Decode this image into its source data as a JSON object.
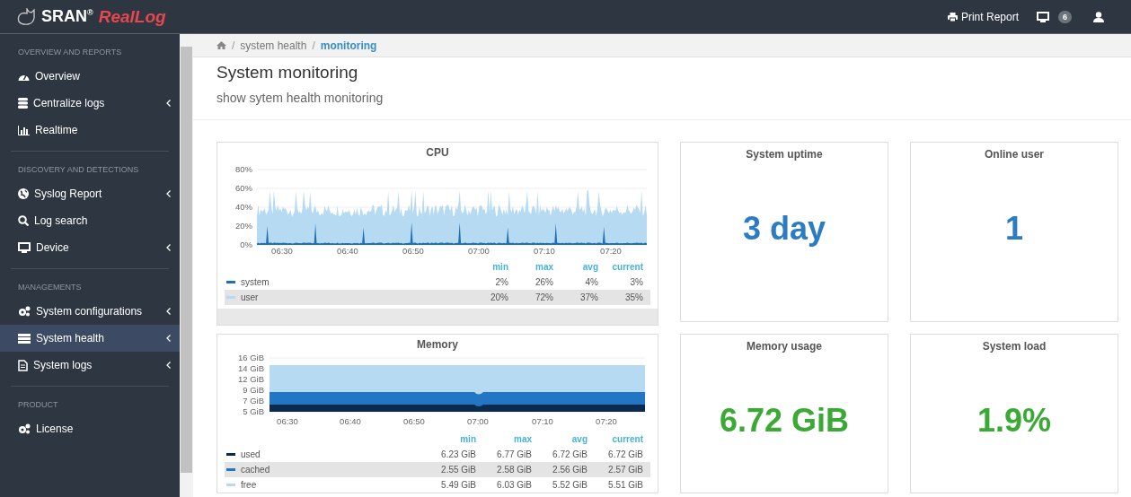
{
  "brand": {
    "name": "SRAN",
    "mark": "®",
    "product": "RealLog"
  },
  "topbar": {
    "print": "Print Report",
    "badge": "6"
  },
  "sidebar": {
    "sections": [
      {
        "title": "OVERVIEW AND REPORTS",
        "items": [
          {
            "label": "Overview",
            "expandable": false,
            "selected": false
          },
          {
            "label": "Centralize logs",
            "expandable": true,
            "selected": false
          },
          {
            "label": "Realtime",
            "expandable": false,
            "selected": false
          }
        ]
      },
      {
        "title": "DISCOVERY AND DETECTIONS",
        "items": [
          {
            "label": "Syslog Report",
            "expandable": true,
            "selected": false
          },
          {
            "label": "Log search",
            "expandable": false,
            "selected": false
          },
          {
            "label": "Device",
            "expandable": true,
            "selected": false
          }
        ]
      },
      {
        "title": "MANAGEMENTS",
        "items": [
          {
            "label": "System configurations",
            "expandable": true,
            "selected": false
          },
          {
            "label": "System health",
            "expandable": true,
            "selected": true
          },
          {
            "label": "System logs",
            "expandable": true,
            "selected": false
          }
        ]
      },
      {
        "title": "PRODUCT",
        "items": [
          {
            "label": "License",
            "expandable": false,
            "selected": false
          }
        ]
      }
    ]
  },
  "breadcrumb": {
    "separator": "/",
    "items": [
      "system health",
      "monitoring"
    ]
  },
  "page": {
    "title": "System monitoring",
    "subtitle": "show sytem health monitoring"
  },
  "cpu": {
    "title": "CPU",
    "y_ticks": [
      "80%",
      "60%",
      "40%",
      "20%",
      "0%"
    ],
    "x_ticks": [
      "06:30",
      "06:40",
      "06:50",
      "07:00",
      "07:10",
      "07:20"
    ],
    "columns": [
      "min",
      "max",
      "avg",
      "current"
    ],
    "rows": [
      {
        "name": "system",
        "color": "#1f6fb5",
        "highlighted": false,
        "values": [
          "2%",
          "26%",
          "4%",
          "3%"
        ]
      },
      {
        "name": "user",
        "color": "#b5daf2",
        "highlighted": true,
        "values": [
          "20%",
          "72%",
          "37%",
          "35%"
        ]
      }
    ]
  },
  "memory": {
    "title": "Memory",
    "y_ticks": [
      "16 GiB",
      "14 GiB",
      "12 GiB",
      "9 GiB",
      "7 GiB",
      "5 GiB"
    ],
    "x_ticks": [
      "06:30",
      "06:40",
      "06:50",
      "07:00",
      "07:10",
      "07:20"
    ],
    "columns": [
      "min",
      "max",
      "avg",
      "current"
    ],
    "rows": [
      {
        "name": "used",
        "color": "#0b2a4e",
        "highlighted": false,
        "values": [
          "6.23 GiB",
          "6.77 GiB",
          "6.72 GiB",
          "6.72 GiB"
        ]
      },
      {
        "name": "cached",
        "color": "#2277c4",
        "highlighted": true,
        "values": [
          "2.55 GiB",
          "2.58 GiB",
          "2.56 GiB",
          "2.57 GiB"
        ]
      },
      {
        "name": "free",
        "color": "#b5daf2",
        "highlighted": false,
        "values": [
          "5.49 GiB",
          "6.03 GiB",
          "5.52 GiB",
          "5.51 GiB"
        ]
      }
    ]
  },
  "stats": [
    {
      "title": "System uptime",
      "value": "3 day",
      "color": "#2a7cc4"
    },
    {
      "title": "Online user",
      "value": "1",
      "color": "#2a7cc4"
    },
    {
      "title": "Memory usage",
      "value": "6.72 GiB",
      "color": "#3aaa35"
    },
    {
      "title": "System load",
      "value": "1.9%",
      "color": "#3aaa35"
    }
  ]
}
